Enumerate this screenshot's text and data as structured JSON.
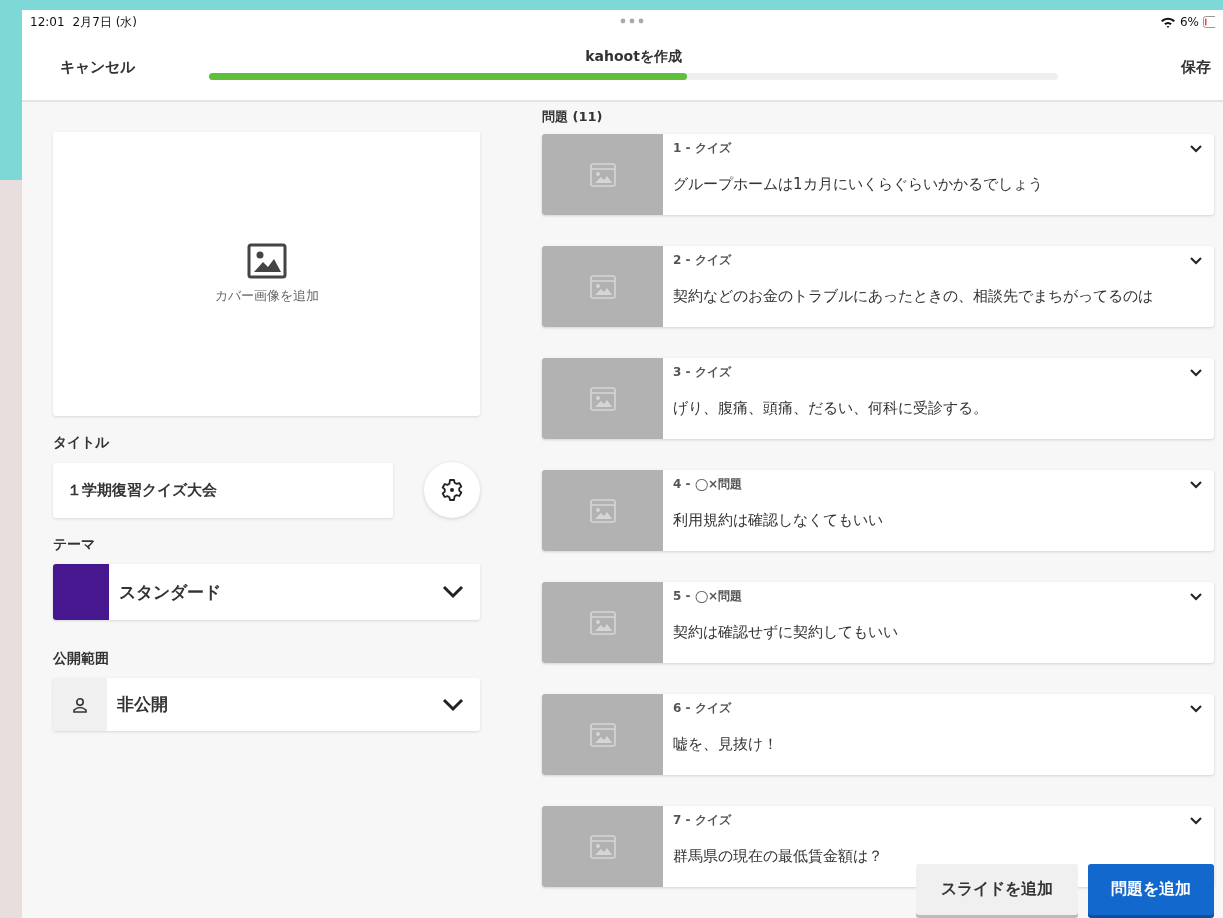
{
  "status_bar": {
    "time": "12:01",
    "date": "2月7日 (水)",
    "battery": "6%"
  },
  "header": {
    "cancel": "キャンセル",
    "title": "kahootを作成",
    "save": "保存",
    "progress": {
      "level": 0.563
    }
  },
  "cover": {
    "label": "カバー画像を追加"
  },
  "title_field": {
    "label": "タイトル",
    "value": "１学期復習クイズ大会"
  },
  "theme": {
    "label": "テーマ",
    "value": "スタンダード"
  },
  "visibility": {
    "label": "公開範囲",
    "value": "非公開"
  },
  "questions": {
    "heading": "問題 (11)",
    "items": [
      {
        "label": "1 - クイズ",
        "text": "グループホームは1カ月にいくらぐらいかかるでしょう"
      },
      {
        "label": "2 - クイズ",
        "text": "契約などのお金のトラブルにあったときの、相談先でまちがってるのは"
      },
      {
        "label": "3 - クイズ",
        "text": "げり、腹痛、頭痛、だるい、何科に受診する。"
      },
      {
        "label": "4 - ◯×問題",
        "text": "利用規約は確認しなくてもいい"
      },
      {
        "label": "5 - ◯×問題",
        "text": "契約は確認せずに契約してもいい"
      },
      {
        "label": "6 - クイズ",
        "text": "嘘を、見抜け！"
      },
      {
        "label": "7 - クイズ",
        "text": "群馬県の現在の最低賃金額は？"
      }
    ]
  },
  "buttons": {
    "add_slide": "スライドを追加",
    "add_question": "問題を追加"
  }
}
